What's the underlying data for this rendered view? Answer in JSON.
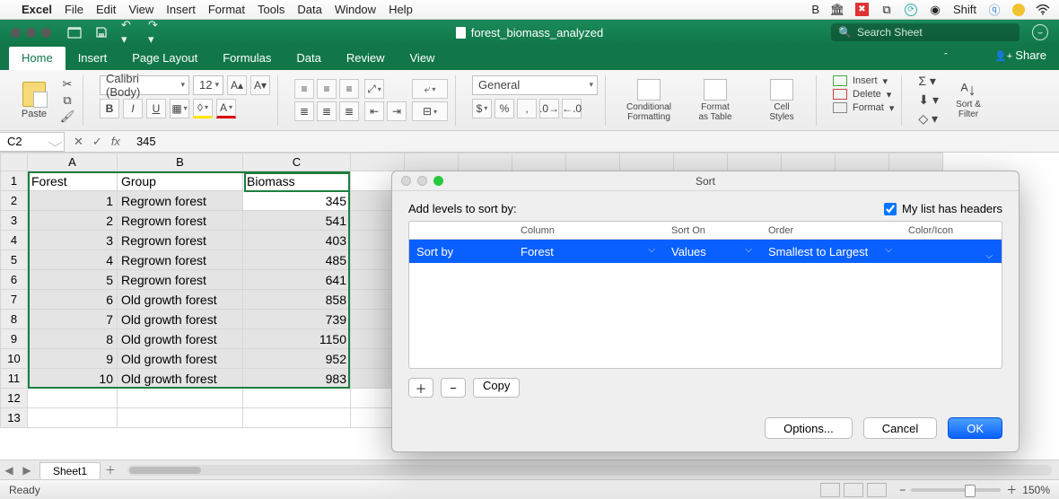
{
  "mac_menu": {
    "app": "Excel",
    "items": [
      "File",
      "Edit",
      "View",
      "Insert",
      "Format",
      "Tools",
      "Data",
      "Window",
      "Help"
    ],
    "right_text": "B",
    "right_app": "Shift"
  },
  "window": {
    "title_prefix": "",
    "doc_name": "forest_biomass_analyzed",
    "search_placeholder": "Search Sheet"
  },
  "ribbon_tabs": [
    "Home",
    "Insert",
    "Page Layout",
    "Formulas",
    "Data",
    "Review",
    "View"
  ],
  "share_label": "Share",
  "ribbon": {
    "paste": "Paste",
    "font_name": "Calibri (Body)",
    "font_size": "12",
    "number_format": "General",
    "cond_fmt": "Conditional\nFormatting",
    "fmt_table": "Format\nas Table",
    "cell_styles": "Cell\nStyles",
    "insert": "Insert",
    "delete": "Delete",
    "format": "Format",
    "sort_filter": "Sort &\nFilter"
  },
  "formula_bar": {
    "namebox": "C2",
    "formula": "345"
  },
  "columns": [
    "A",
    "B",
    "C"
  ],
  "headers": {
    "A": "Forest",
    "B": "Group",
    "C": "Biomass"
  },
  "rows": [
    {
      "n": "1",
      "A": "1",
      "B": "Regrown forest",
      "C": "345"
    },
    {
      "n": "2",
      "A": "2",
      "B": "Regrown forest",
      "C": "541"
    },
    {
      "n": "3",
      "A": "3",
      "B": "Regrown forest",
      "C": "403"
    },
    {
      "n": "4",
      "A": "4",
      "B": "Regrown forest",
      "C": "485"
    },
    {
      "n": "5",
      "A": "5",
      "B": "Regrown forest",
      "C": "641"
    },
    {
      "n": "6",
      "A": "6",
      "B": "Old growth forest",
      "C": "858"
    },
    {
      "n": "7",
      "A": "7",
      "B": "Old growth forest",
      "C": "739"
    },
    {
      "n": "8",
      "A": "8",
      "B": "Old growth forest",
      "C": "1150"
    },
    {
      "n": "9",
      "A": "9",
      "B": "Old growth forest",
      "C": "952"
    },
    {
      "n": "10",
      "A": "10",
      "B": "Old growth forest",
      "C": "983"
    }
  ],
  "sort_dialog": {
    "title": "Sort",
    "instruction": "Add levels to sort by:",
    "headers_checkbox_label": "My list has headers",
    "headers_checked": true,
    "cols": {
      "sortby": "",
      "column": "Column",
      "sorton": "Sort On",
      "order": "Order",
      "ci": "Color/Icon"
    },
    "row": {
      "label": "Sort by",
      "column": "Forest",
      "sorton": "Values",
      "order": "Smallest to Largest"
    },
    "copy": "Copy",
    "options": "Options...",
    "cancel": "Cancel",
    "ok": "OK"
  },
  "sheet_tab": "Sheet1",
  "status": {
    "ready": "Ready",
    "zoom": "150%"
  }
}
